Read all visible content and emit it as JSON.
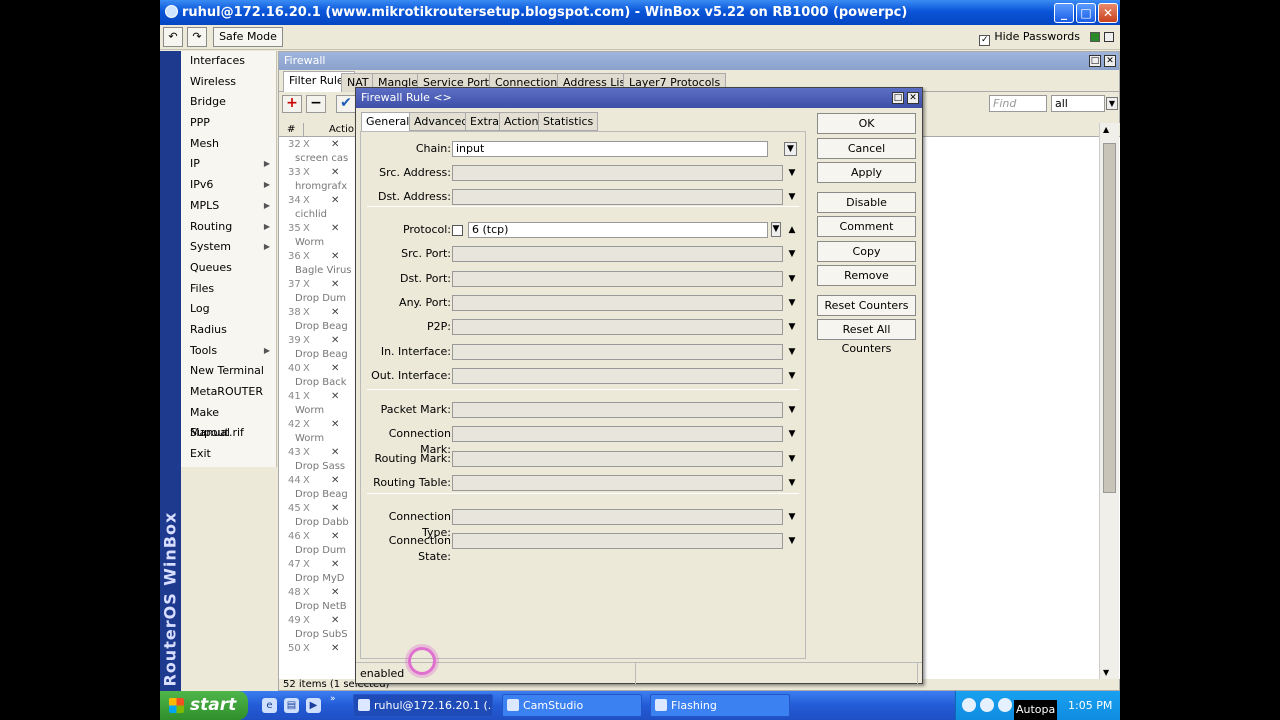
{
  "window": {
    "title": "ruhul@172.16.20.1 (www.mikrotikroutersetup.blogspot.com) - WinBox v5.22 on RB1000 (powerpc)"
  },
  "toolbar": {
    "safe_mode": "Safe Mode",
    "hide_passwords": "Hide Passwords",
    "hide_passwords_checked": true
  },
  "sideband": "RouterOS WinBox",
  "menu": [
    {
      "label": "Interfaces",
      "sub": false
    },
    {
      "label": "Wireless",
      "sub": false
    },
    {
      "label": "Bridge",
      "sub": false
    },
    {
      "label": "PPP",
      "sub": false
    },
    {
      "label": "Mesh",
      "sub": false
    },
    {
      "label": "IP",
      "sub": true
    },
    {
      "label": "IPv6",
      "sub": true
    },
    {
      "label": "MPLS",
      "sub": true
    },
    {
      "label": "Routing",
      "sub": true
    },
    {
      "label": "System",
      "sub": true
    },
    {
      "label": "Queues",
      "sub": false
    },
    {
      "label": "Files",
      "sub": false
    },
    {
      "label": "Log",
      "sub": false
    },
    {
      "label": "Radius",
      "sub": false
    },
    {
      "label": "Tools",
      "sub": true
    },
    {
      "label": "New Terminal",
      "sub": false
    },
    {
      "label": "MetaROUTER",
      "sub": false
    },
    {
      "label": "Make Supout.rif",
      "sub": false
    },
    {
      "label": "Manual",
      "sub": false
    },
    {
      "label": "Exit",
      "sub": false
    }
  ],
  "firewall": {
    "title": "Firewall",
    "tabs": [
      "Filter Rules",
      "NAT",
      "Mangle",
      "Service Ports",
      "Connections",
      "Address Lists",
      "Layer7 Protocols"
    ],
    "find_placeholder": "Find",
    "find_filter": "all",
    "columns": {
      "num": "#",
      "action": "Actio"
    },
    "rows": [
      {
        "num": "32",
        "flag": "X",
        "comment": "screen cas"
      },
      {
        "num": "33",
        "flag": "X",
        "comment": "hromgrafx"
      },
      {
        "num": "34",
        "flag": "X",
        "comment": "cichlid"
      },
      {
        "num": "35",
        "flag": "X",
        "comment": "Worm"
      },
      {
        "num": "36",
        "flag": "X",
        "comment": "Bagle Virus"
      },
      {
        "num": "37",
        "flag": "X",
        "comment": "Drop Dum"
      },
      {
        "num": "38",
        "flag": "X",
        "comment": "Drop Beag"
      },
      {
        "num": "39",
        "flag": "X",
        "comment": "Drop Beag"
      },
      {
        "num": "40",
        "flag": "X",
        "comment": "Drop Back"
      },
      {
        "num": "41",
        "flag": "X",
        "comment": "Worm"
      },
      {
        "num": "42",
        "flag": "X",
        "comment": "Worm"
      },
      {
        "num": "43",
        "flag": "X",
        "comment": "Drop Sass"
      },
      {
        "num": "44",
        "flag": "X",
        "comment": "Drop Beag"
      },
      {
        "num": "45",
        "flag": "X",
        "comment": "Drop Dabb"
      },
      {
        "num": "46",
        "flag": "X",
        "comment": "Drop Dum"
      },
      {
        "num": "47",
        "flag": "X",
        "comment": "Drop MyD"
      },
      {
        "num": "48",
        "flag": "X",
        "comment": "Drop NetB"
      },
      {
        "num": "49",
        "flag": "X",
        "comment": "Drop SubS"
      },
      {
        "num": "50",
        "flag": "X",
        "comment": ""
      }
    ],
    "selected_row": "51",
    "status": "52 items (1 selected)"
  },
  "dialog": {
    "title": "Firewall Rule <>",
    "tabs": [
      "General",
      "Advanced",
      "Extra",
      "Action",
      "Statistics"
    ],
    "fields": {
      "chain": {
        "label": "Chain:",
        "value": "input"
      },
      "src_address": {
        "label": "Src. Address:",
        "value": ""
      },
      "dst_address": {
        "label": "Dst. Address:",
        "value": ""
      },
      "protocol": {
        "label": "Protocol:",
        "value": "6 (tcp)"
      },
      "src_port": {
        "label": "Src. Port:",
        "value": ""
      },
      "dst_port": {
        "label": "Dst. Port:",
        "value": ""
      },
      "any_port": {
        "label": "Any. Port:",
        "value": ""
      },
      "p2p": {
        "label": "P2P:",
        "value": ""
      },
      "in_interface": {
        "label": "In. Interface:",
        "value": ""
      },
      "out_interface": {
        "label": "Out. Interface:",
        "value": ""
      },
      "packet_mark": {
        "label": "Packet Mark:",
        "value": ""
      },
      "connection_mark": {
        "label": "Connection Mark:",
        "value": ""
      },
      "routing_mark": {
        "label": "Routing Mark:",
        "value": ""
      },
      "routing_table": {
        "label": "Routing Table:",
        "value": ""
      },
      "connection_type": {
        "label": "Connection Type:",
        "value": ""
      },
      "connection_state": {
        "label": "Connection State:",
        "value": ""
      }
    },
    "buttons": {
      "ok": "OK",
      "cancel": "Cancel",
      "apply": "Apply",
      "disable": "Disable",
      "comment": "Comment",
      "copy": "Copy",
      "remove": "Remove",
      "reset_counters": "Reset Counters",
      "reset_all_counters": "Reset All Counters"
    },
    "status": "enabled"
  },
  "taskbar": {
    "start": "start",
    "tasks": [
      "ruhul@172.16.20.1 (...",
      "CamStudio",
      "Flashing"
    ],
    "tray_text": "Autopa",
    "clock": "1:05 PM"
  }
}
